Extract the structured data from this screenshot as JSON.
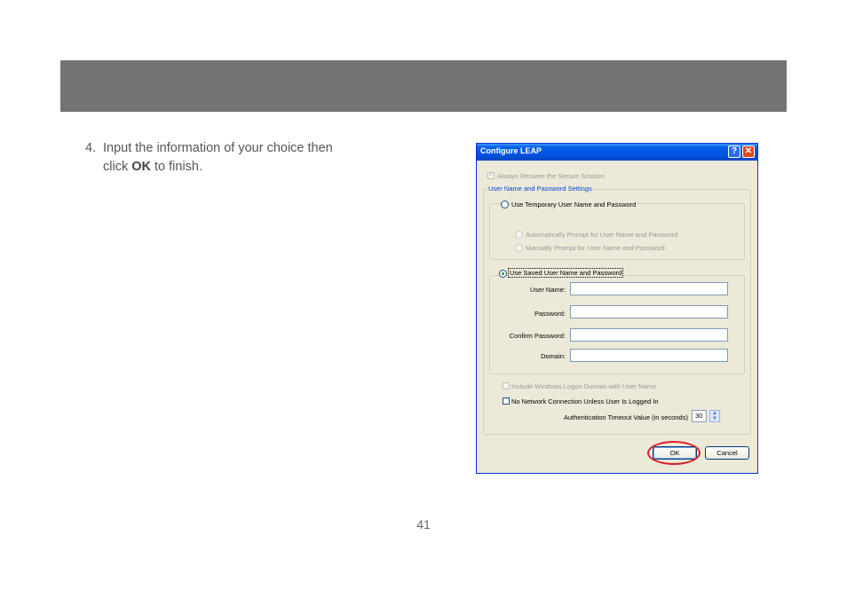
{
  "instruction": {
    "number": "4.",
    "text_part1": "Input the information of your choice then",
    "text_part2_prefix": "click ",
    "text_bold": "OK",
    "text_part2_suffix": " to finish."
  },
  "page_number": "41",
  "dialog": {
    "title": "Configure LEAP",
    "help_glyph": "?",
    "close_glyph": "✕",
    "always_resume": "Always Resume the Secure Session",
    "group_title": "User Name and Password Settings",
    "temp_radio": "Use Temporary User Name and Password",
    "auto_prompt": "Automatically Prompt for User Name and Password",
    "manual_prompt": "Manually Prompt for User Name and Password",
    "saved_radio": "Use Saved User Name and Password",
    "fields": {
      "username_label": "User Name:",
      "password_label": "Password:",
      "confirm_label": "Confirm Password:",
      "domain_label": "Domain:",
      "username_value": "",
      "password_value": "",
      "confirm_value": "",
      "domain_value": ""
    },
    "include_domain": "Include Windows Logon Domain with User Name",
    "no_network": "No Network Connection Unless User Is Logged In",
    "timeout_label": "Authentication Timeout Value (in seconds)",
    "timeout_value": "30",
    "ok_label": "OK",
    "cancel_label": "Cancel"
  },
  "colors": {
    "header_band": "#727372",
    "highlight": "#e01c24",
    "title_bar": "#0054e3"
  }
}
